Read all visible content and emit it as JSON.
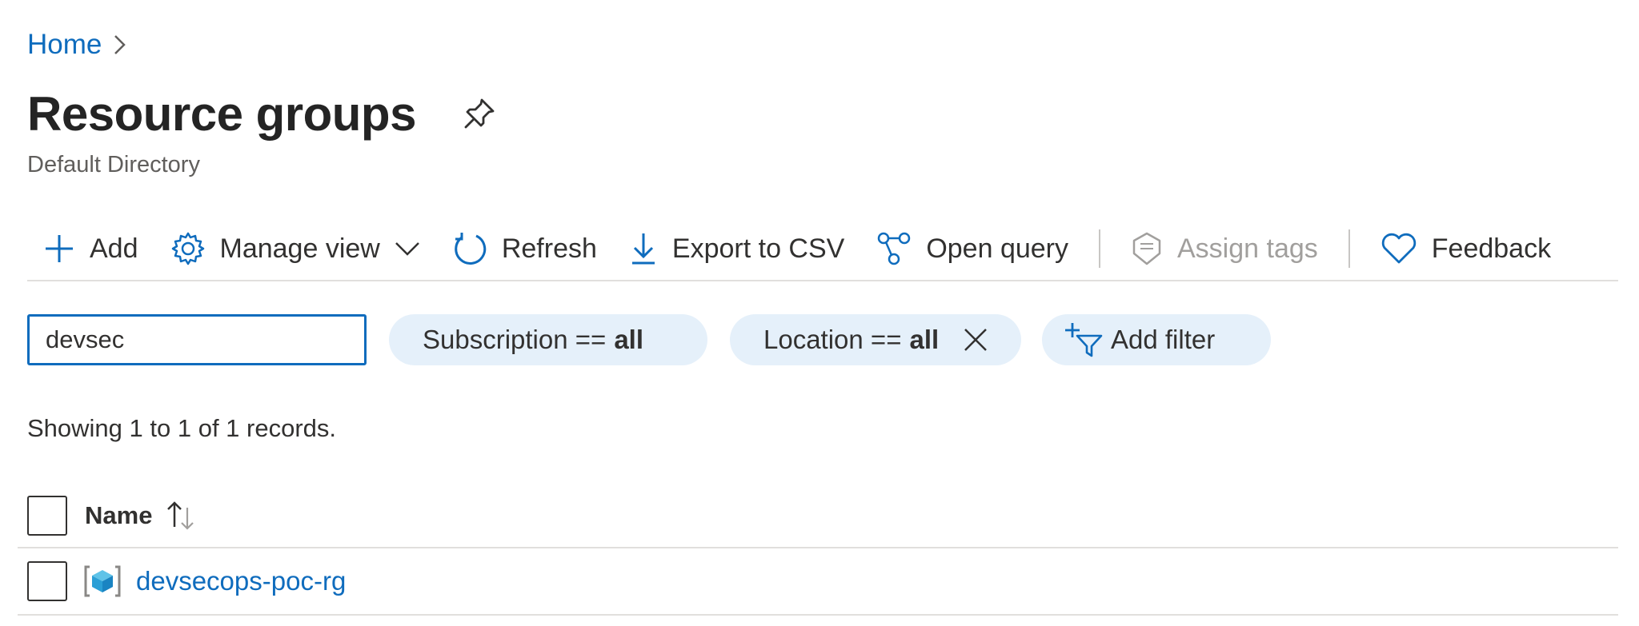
{
  "breadcrumb": {
    "home": "Home"
  },
  "header": {
    "title": "Resource groups",
    "subtitle": "Default Directory"
  },
  "toolbar": {
    "add": "Add",
    "manage_view": "Manage view",
    "refresh": "Refresh",
    "export_csv": "Export to CSV",
    "open_query": "Open query",
    "assign_tags": "Assign tags",
    "feedback": "Feedback"
  },
  "filters": {
    "search_value": "devsec",
    "subscription": {
      "label": "Subscription ==",
      "value": "all"
    },
    "location": {
      "label": "Location ==",
      "value": "all"
    },
    "add_filter": "Add filter"
  },
  "records_text": "Showing 1 to 1 of 1 records.",
  "table": {
    "columns": {
      "name": "Name"
    },
    "rows": [
      {
        "name": "devsecops-poc-rg"
      }
    ]
  },
  "colors": {
    "accent": "#0f6cbd",
    "pill_bg": "#e5f0fa",
    "disabled": "#a19f9d"
  }
}
